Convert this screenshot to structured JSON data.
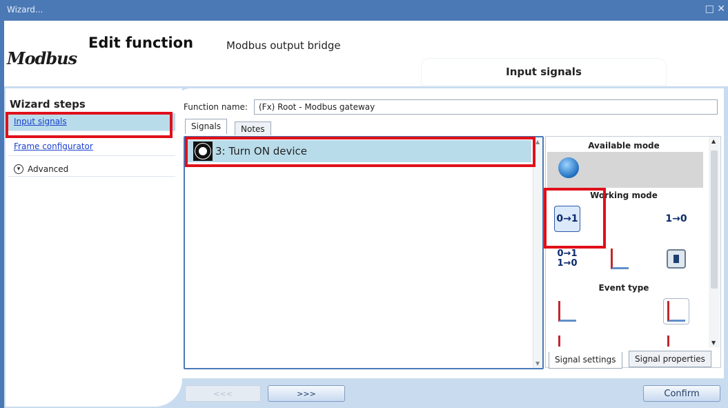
{
  "window": {
    "title": "Wizard...",
    "controls": "□ ✕"
  },
  "header": {
    "logo_text": "Modbus",
    "title": "Edit function",
    "subtitle": "Modbus output bridge",
    "current_step": "Input signals"
  },
  "sidebar": {
    "title": "Wizard steps",
    "items": [
      {
        "label": "Input signals",
        "selected": true
      },
      {
        "label": "Frame configurator",
        "selected": false
      },
      {
        "label": "Advanced",
        "expandable": true
      }
    ]
  },
  "form": {
    "function_name_label": "Function name:",
    "function_name_value": "(Fx) Root - Modbus gateway"
  },
  "tabs": [
    {
      "label": "Signals",
      "active": true
    },
    {
      "label": "Notes",
      "active": false
    }
  ],
  "signals": [
    {
      "label": "3: Turn ON device",
      "icon": "signal-device-icon"
    }
  ],
  "mode_panel": {
    "available_mode_title": "Available mode",
    "working_mode_title": "Working mode",
    "event_type_title": "Event type",
    "working_modes": [
      {
        "label": "0→1",
        "selected": true
      },
      {
        "label": "1→0",
        "selected": false
      },
      {
        "label": "0→1\n1→0",
        "selected": false
      }
    ]
  },
  "bottom_tabs": [
    {
      "label": "Signal settings",
      "active": true
    },
    {
      "label": "Signal properties",
      "active": false
    }
  ],
  "nav": {
    "prev_label": "<<<",
    "next_label": ">>>",
    "confirm_label": "Confirm"
  },
  "colors": {
    "titlebar": "#4a79b6",
    "panel_background": "#c9dcef",
    "selection": "#b9dcea",
    "highlight": "#e0101a"
  }
}
